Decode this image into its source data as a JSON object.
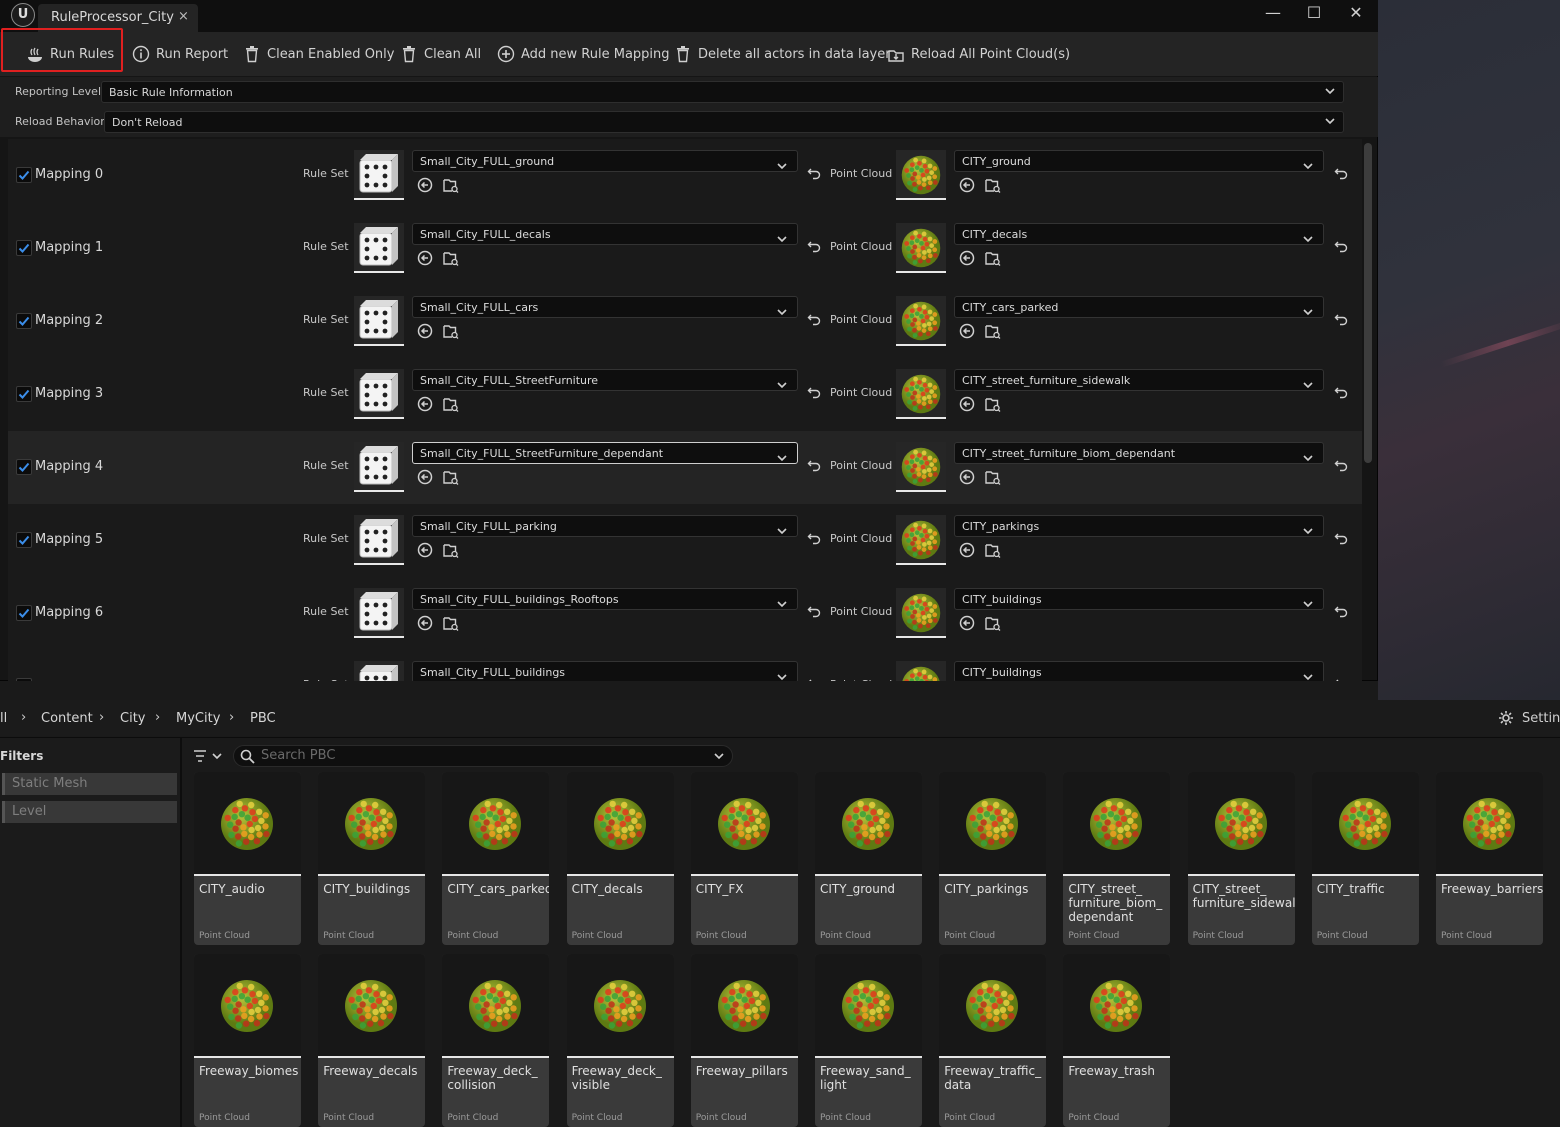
{
  "window": {
    "tab_title": "RuleProcessor_City",
    "tab_close": "×",
    "logo": "U"
  },
  "window_controls": {
    "minimize": "—",
    "maximize": "☐",
    "close": "✕"
  },
  "toolbar": {
    "run_rules": "Run Rules",
    "run_report": "Run Report",
    "clean_enabled_only": "Clean Enabled Only",
    "clean_all": "Clean All",
    "add_mapping": "Add new Rule Mapping",
    "delete_actors": "Delete all actors in data layer",
    "reload_point_clouds": "Reload All Point Cloud(s)"
  },
  "properties": {
    "reporting_level_label": "Reporting Level",
    "reporting_level_value": "Basic Rule Information",
    "reload_behavior_label": "Reload Behavior",
    "reload_behavior_value": "Don't Reload"
  },
  "mapping_labels": {
    "rule_set": "Rule Set",
    "point_cloud": "Point Cloud"
  },
  "mappings": [
    {
      "label": "Mapping 0",
      "enabled": true,
      "rule_set": "Small_City_FULL_ground",
      "point_cloud": "CITY_ground"
    },
    {
      "label": "Mapping 1",
      "enabled": true,
      "rule_set": "Small_City_FULL_decals",
      "point_cloud": "CITY_decals"
    },
    {
      "label": "Mapping 2",
      "enabled": true,
      "rule_set": "Small_City_FULL_cars",
      "point_cloud": "CITY_cars_parked"
    },
    {
      "label": "Mapping 3",
      "enabled": true,
      "rule_set": "Small_City_FULL_StreetFurniture",
      "point_cloud": "CITY_street_furniture_sidewalk"
    },
    {
      "label": "Mapping 4",
      "enabled": true,
      "rule_set": "Small_City_FULL_StreetFurniture_dependant",
      "point_cloud": "CITY_street_furniture_biom_dependant"
    },
    {
      "label": "Mapping 5",
      "enabled": true,
      "rule_set": "Small_City_FULL_parking",
      "point_cloud": "CITY_parkings"
    },
    {
      "label": "Mapping 6",
      "enabled": true,
      "rule_set": "Small_City_FULL_buildings_Rooftops",
      "point_cloud": "CITY_buildings"
    },
    {
      "label": "",
      "enabled": true,
      "rule_set": "Small_City_FULL_buildings",
      "point_cloud": "CITY_buildings"
    }
  ],
  "content_browser": {
    "breadcrumb": [
      "ll",
      "Content",
      "City",
      "MyCity",
      "PBC"
    ],
    "settings_label": "Setting",
    "filters_title": "Filters",
    "filters": [
      "Static Mesh",
      "Level"
    ],
    "search_placeholder": "Search PBC",
    "asset_type": "Point Cloud",
    "assets": [
      "CITY_audio",
      "CITY_buildings",
      "CITY_cars_parked",
      "CITY_decals",
      "CITY_FX",
      "CITY_ground",
      "CITY_parkings",
      "CITY_street_\nfurniture_biom_\ndependant",
      "CITY_street_\nfurniture_sidewalk",
      "CITY_traffic",
      "Freeway_barriers",
      "Freeway_biomes",
      "Freeway_decals",
      "Freeway_deck_\ncollision",
      "Freeway_deck_\nvisible",
      "Freeway_pillars",
      "Freeway_sand_\nlight",
      "Freeway_traffic_\ndata",
      "Freeway_trash"
    ]
  },
  "colors": {
    "highlight_border": "#e02020",
    "checkbox_check": "#3b8eea",
    "panel_bg": "#1a1a1a"
  }
}
